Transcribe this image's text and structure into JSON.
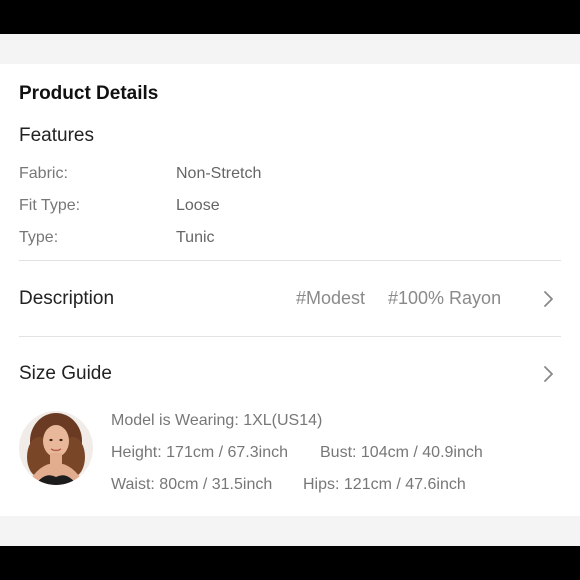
{
  "product": {
    "title": "Product Details",
    "features_heading": "Features",
    "features": [
      {
        "label": "Fabric:",
        "value": "Non-Stretch"
      },
      {
        "label": "Fit Type:",
        "value": "Loose"
      },
      {
        "label": "Type:",
        "value": "Tunic"
      }
    ],
    "description": {
      "label": "Description",
      "tags": [
        "#Modest",
        "#100% Rayon"
      ]
    },
    "size_guide": {
      "label": "Size Guide",
      "model_wearing": "Model is Wearing: 1XL(US14)",
      "height": "Height: 171cm / 67.3inch",
      "bust": "Bust: 104cm / 40.9inch",
      "waist": "Waist: 80cm / 31.5inch",
      "hips": "Hips: 121cm / 47.6inch"
    }
  },
  "icons": {
    "chevron": "chevron-right-icon"
  },
  "colors": {
    "background": "#f4f4f4",
    "card": "#ffffff",
    "text": "#222222",
    "muted": "#777777",
    "frame": "#000000"
  }
}
